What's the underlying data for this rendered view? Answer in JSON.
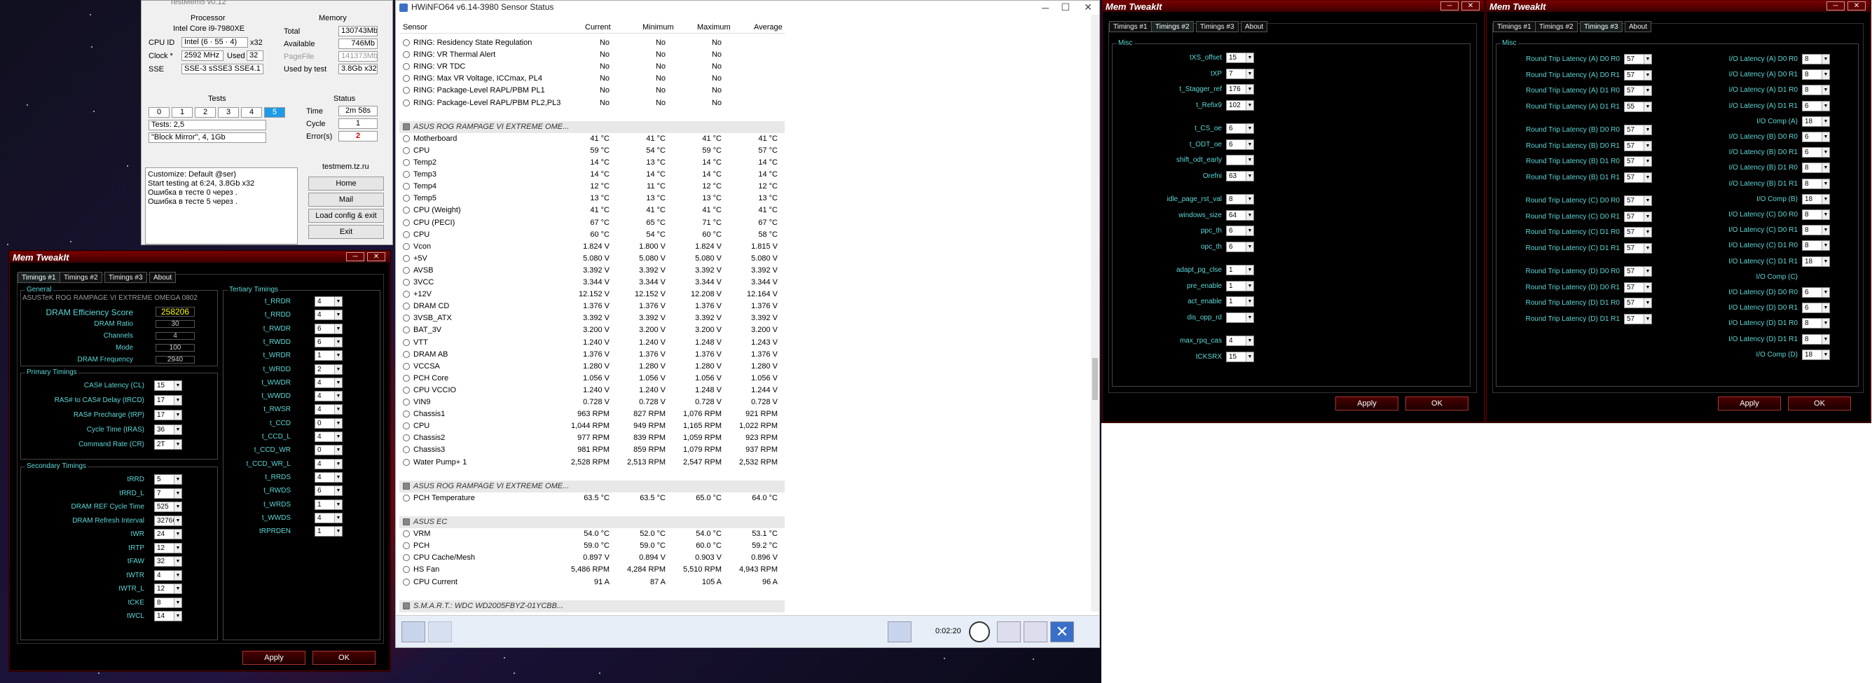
{
  "testmem": {
    "title": "TestMem5 v0.12",
    "proc_hdr": "Processor",
    "cpu": "Intel Core i9-7980XE",
    "cpuid_lbl": "CPU ID",
    "cpuid": "Intel (6 · 55 · 4)",
    "cpuid_x": "x32",
    "clock_lbl": "Clock *",
    "clock": "2592 MHz",
    "used_lbl": "Used",
    "used": "32",
    "sse_lbl": "SSE",
    "sse": "SSE-3 sSSE3 SSE4.1",
    "mem_hdr": "Memory",
    "total_lbl": "Total",
    "total": "130743Mb",
    "avail_lbl": "Available",
    "avail": "746Mb",
    "pagefile_lbl": "PageFile",
    "pagefile": "141373Mb",
    "usedby_lbl": "Used by test",
    "usedby": "3.8Gb x32",
    "tests_hdr": "Tests",
    "tests_nums": [
      "0",
      "1",
      "2",
      "3",
      "4",
      "5"
    ],
    "tests_line": "Tests: 2,5",
    "tests_mode": "\"Block Mirror\", 4, 1Gb",
    "status_hdr": "Status",
    "time_lbl": "Time",
    "time": "2m 58s",
    "cycle_lbl": "Cycle",
    "cycle": "1",
    "errors_lbl": "Error(s)",
    "errors": "2",
    "site": "testmem.tz.ru",
    "log": [
      "Customize: Default @ser)",
      "Start testing at 6:24, 3.8Gb x32",
      "Ошибка в тесте 0 через .",
      "Ошибка в тесте 5 через ."
    ],
    "btn_home": "Home",
    "btn_mail": "Mail",
    "btn_load": "Load config & exit",
    "btn_exit": "Exit"
  },
  "mt1": {
    "title": "Mem TweakIt",
    "tabs": [
      "Timings #1",
      "Timings #2",
      "Timings #3",
      "About"
    ],
    "general_lbl": "General",
    "board": "ASUSTeK ROG RAMPAGE VI EXTREME OMEGA 0802",
    "eff_lbl": "DRAM Efficiency Score",
    "eff": "258206",
    "ratio_lbl": "DRAM Ratio",
    "ratio": "30",
    "ch_lbl": "Channels",
    "ch": "4",
    "mode_lbl": "Mode",
    "mode": "100",
    "freq_lbl": "DRAM Frequency",
    "freq": "2940",
    "primary_lbl": "Primary Timings",
    "primary": [
      {
        "l": "CAS# Latency (CL)",
        "v": "15"
      },
      {
        "l": "RAS# to CAS# Delay (tRCD)",
        "v": "17"
      },
      {
        "l": "RAS# Precharge (tRP)",
        "v": "17"
      },
      {
        "l": "Cycle Time (tRAS)",
        "v": "36"
      },
      {
        "l": "Command Rate (CR)",
        "v": "2T"
      }
    ],
    "secondary_lbl": "Secondary Timings",
    "secondary": [
      {
        "l": "tRRD",
        "v": "5"
      },
      {
        "l": "tRRD_L",
        "v": "7"
      },
      {
        "l": "DRAM REF Cycle Time",
        "v": "525"
      },
      {
        "l": "DRAM Refresh Interval",
        "v": "32766"
      },
      {
        "l": "tWR",
        "v": "24"
      },
      {
        "l": "tRTP",
        "v": "12"
      },
      {
        "l": "tFAW",
        "v": "32"
      },
      {
        "l": "tWTR",
        "v": "4"
      },
      {
        "l": "tWTR_L",
        "v": "12"
      },
      {
        "l": "tCKE",
        "v": "8"
      },
      {
        "l": "tWCL",
        "v": "14"
      }
    ],
    "tertiary_lbl": "Tertiary Timings",
    "tertiary": [
      {
        "l": "t_RRDR",
        "v": "4"
      },
      {
        "l": "t_RRDD",
        "v": "4"
      },
      {
        "l": "t_RWDR",
        "v": "6"
      },
      {
        "l": "t_RWDD",
        "v": "6"
      },
      {
        "l": "t_WRDR",
        "v": "1"
      },
      {
        "l": "t_WRDD",
        "v": "2"
      },
      {
        "l": "t_WWDR",
        "v": "4"
      },
      {
        "l": "t_WWDD",
        "v": "4"
      },
      {
        "l": "t_RWSR",
        "v": "4"
      },
      {
        "l": "t_CCD",
        "v": "0"
      },
      {
        "l": "t_CCD_L",
        "v": "4"
      },
      {
        "l": "t_CCD_WR",
        "v": "0"
      },
      {
        "l": "t_CCD_WR_L",
        "v": "4"
      },
      {
        "l": "t_RRDS",
        "v": "4"
      },
      {
        "l": "t_RWDS",
        "v": "6"
      },
      {
        "l": "t_WRDS",
        "v": "1"
      },
      {
        "l": "t_WWDS",
        "v": "4"
      },
      {
        "l": "tRPRDEN",
        "v": "1"
      }
    ],
    "apply": "Apply",
    "ok": "OK"
  },
  "mt2": {
    "title": "Mem TweakIt",
    "tabs": [
      "Timings #1",
      "Timings #2",
      "Timings #3",
      "About"
    ],
    "misc_lbl": "Misc",
    "rows": [
      {
        "l": "tXS_offset",
        "v": "15"
      },
      {
        "l": "tXP",
        "v": "7"
      },
      {
        "l": "t_Stagger_ref",
        "v": "176"
      },
      {
        "l": "t_Refix9",
        "v": "102"
      },
      {
        "l": "t_CS_oe",
        "v": "6"
      },
      {
        "l": "t_ODT_oe",
        "v": "6"
      },
      {
        "l": "shift_odt_early",
        "v": ""
      },
      {
        "l": "Orefni",
        "v": "63"
      },
      {
        "l": "idle_page_rst_val",
        "v": "8"
      },
      {
        "l": "windows_size",
        "v": "64"
      },
      {
        "l": "ppc_th",
        "v": "6"
      },
      {
        "l": "opc_th",
        "v": "6"
      },
      {
        "l": "adapt_pg_clse",
        "v": "1"
      },
      {
        "l": "pre_enable",
        "v": "1"
      },
      {
        "l": "act_enable",
        "v": "1"
      },
      {
        "l": "dis_opp_rd",
        "v": ""
      },
      {
        "l": "max_rpq_cas",
        "v": "4"
      },
      {
        "l": "tCKSRX",
        "v": "15"
      }
    ],
    "apply": "Apply",
    "ok": "OK"
  },
  "mt3": {
    "title": "Mem TweakIt",
    "tabs": [
      "Timings #1",
      "Timings #2",
      "Timings #3",
      "About"
    ],
    "misc_lbl": "Misc",
    "left": [
      {
        "l": "Round Trip Latency (A) D0 R0",
        "v": "57"
      },
      {
        "l": "Round Trip Latency (A) D0 R1",
        "v": "57"
      },
      {
        "l": "Round Trip Latency (A) D1 R0",
        "v": "57"
      },
      {
        "l": "Round Trip Latency (A) D1 R1",
        "v": "55"
      },
      {
        "l": "Round Trip Latency (B) D0 R0",
        "v": "57"
      },
      {
        "l": "Round Trip Latency (B) D0 R1",
        "v": "57"
      },
      {
        "l": "Round Trip Latency (B) D1 R0",
        "v": "57"
      },
      {
        "l": "Round Trip Latency (B) D1 R1",
        "v": "57"
      },
      {
        "l": "Round Trip Latency (C) D0 R0",
        "v": "57"
      },
      {
        "l": "Round Trip Latency (C) D0 R1",
        "v": "57"
      },
      {
        "l": "Round Trip Latency (C) D1 R0",
        "v": "57"
      },
      {
        "l": "Round Trip Latency (C) D1 R1",
        "v": "57"
      },
      {
        "l": "Round Trip Latency (D) D0 R0",
        "v": "57"
      },
      {
        "l": "Round Trip Latency (D) D0 R1",
        "v": "57"
      },
      {
        "l": "Round Trip Latency (D) D1 R0",
        "v": "57"
      },
      {
        "l": "Round Trip Latency (D) D1 R1",
        "v": "57"
      }
    ],
    "right": [
      {
        "l": "I/O Latency (A) D0 R0",
        "v": "8"
      },
      {
        "l": "I/O Latency (A) D0 R1",
        "v": "8"
      },
      {
        "l": "I/O Latency (A) D1 R0",
        "v": "8"
      },
      {
        "l": "I/O Latency (A) D1 R1",
        "v": "6"
      },
      {
        "l": "I/O Comp (A)",
        "v": "18"
      },
      {
        "l": "I/O Latency (B) D0 R0",
        "v": "6"
      },
      {
        "l": "I/O Latency (B) D0 R1",
        "v": "6"
      },
      {
        "l": "I/O Latency (B) D1 R0",
        "v": "8"
      },
      {
        "l": "I/O Latency (B) D1 R1",
        "v": "8"
      },
      {
        "l": "I/O Comp (B)",
        "v": "18"
      },
      {
        "l": "I/O Latency (C) D0 R0",
        "v": "8"
      },
      {
        "l": "I/O Latency (C) D0 R1",
        "v": "8"
      },
      {
        "l": "I/O Latency (C) D1 R0",
        "v": "8"
      },
      {
        "l": "I/O Latency (C) D1 R1",
        "v": "18"
      },
      {
        "l": "I/O Comp (C)",
        "v": ""
      },
      {
        "l": "I/O Latency (D) D0 R0",
        "v": "6"
      },
      {
        "l": "I/O Latency (D) D0 R1",
        "v": "6"
      },
      {
        "l": "I/O Latency (D) D1 R0",
        "v": "8"
      },
      {
        "l": "I/O Latency (D) D1 R1",
        "v": "8"
      },
      {
        "l": "I/O Comp (D)",
        "v": "18"
      }
    ],
    "apply": "Apply",
    "ok": "OK"
  },
  "hwinfo": {
    "title": "HWiNFO64 v6.14-3980 Sensor Status",
    "cols": [
      "Sensor",
      "Current",
      "Minimum",
      "Maximum",
      "Average"
    ],
    "rows": [
      {
        "n": "RING: Residency State Regulation",
        "c": "No",
        "mi": "No",
        "ma": "No",
        "a": ""
      },
      {
        "n": "RING: VR Thermal Alert",
        "c": "No",
        "mi": "No",
        "ma": "No",
        "a": ""
      },
      {
        "n": "RING: VR TDC",
        "c": "No",
        "mi": "No",
        "ma": "No",
        "a": ""
      },
      {
        "n": "RING: Max VR Voltage, ICCmax, PL4",
        "c": "No",
        "mi": "No",
        "ma": "No",
        "a": ""
      },
      {
        "n": "RING: Package-Level RAPL/PBM PL1",
        "c": "No",
        "mi": "No",
        "ma": "No",
        "a": ""
      },
      {
        "n": "RING: Package-Level RAPL/PBM PL2,PL3",
        "c": "No",
        "mi": "No",
        "ma": "No",
        "a": ""
      },
      {
        "n": "",
        "c": "",
        "mi": "",
        "ma": "",
        "a": ""
      },
      {
        "n": "ASUS ROG RAMPAGE VI EXTREME OME...",
        "c": "",
        "mi": "",
        "ma": "",
        "a": "",
        "g": true
      },
      {
        "n": "Motherboard",
        "c": "41 °C",
        "mi": "41 °C",
        "ma": "41 °C",
        "a": "41 °C"
      },
      {
        "n": "CPU",
        "c": "59 °C",
        "mi": "54 °C",
        "ma": "59 °C",
        "a": "57 °C"
      },
      {
        "n": "Temp2",
        "c": "14 °C",
        "mi": "13 °C",
        "ma": "14 °C",
        "a": "14 °C"
      },
      {
        "n": "Temp3",
        "c": "14 °C",
        "mi": "14 °C",
        "ma": "14 °C",
        "a": "14 °C"
      },
      {
        "n": "Temp4",
        "c": "12 °C",
        "mi": "11 °C",
        "ma": "12 °C",
        "a": "12 °C"
      },
      {
        "n": "Temp5",
        "c": "13 °C",
        "mi": "13 °C",
        "ma": "13 °C",
        "a": "13 °C"
      },
      {
        "n": "CPU (Weight)",
        "c": "41 °C",
        "mi": "41 °C",
        "ma": "41 °C",
        "a": "41 °C"
      },
      {
        "n": "CPU (PECI)",
        "c": "67 °C",
        "mi": "65 °C",
        "ma": "71 °C",
        "a": "67 °C"
      },
      {
        "n": "CPU",
        "c": "60 °C",
        "mi": "54 °C",
        "ma": "60 °C",
        "a": "58 °C"
      },
      {
        "n": "Vcon",
        "c": "1.824 V",
        "mi": "1.800 V",
        "ma": "1.824 V",
        "a": "1.815 V"
      },
      {
        "n": "+5V",
        "c": "5.080 V",
        "mi": "5.080 V",
        "ma": "5.080 V",
        "a": "5.080 V"
      },
      {
        "n": "AVSB",
        "c": "3.392 V",
        "mi": "3.392 V",
        "ma": "3.392 V",
        "a": "3.392 V"
      },
      {
        "n": "3VCC",
        "c": "3.344 V",
        "mi": "3.344 V",
        "ma": "3.344 V",
        "a": "3.344 V"
      },
      {
        "n": "+12V",
        "c": "12.152 V",
        "mi": "12.152 V",
        "ma": "12.208 V",
        "a": "12.164 V"
      },
      {
        "n": "DRAM CD",
        "c": "1.376 V",
        "mi": "1.376 V",
        "ma": "1.376 V",
        "a": "1.376 V"
      },
      {
        "n": "3VSB_ATX",
        "c": "3.392 V",
        "mi": "3.392 V",
        "ma": "3.392 V",
        "a": "3.392 V"
      },
      {
        "n": "BAT_3V",
        "c": "3.200 V",
        "mi": "3.200 V",
        "ma": "3.200 V",
        "a": "3.200 V"
      },
      {
        "n": "VTT",
        "c": "1.240 V",
        "mi": "1.240 V",
        "ma": "1.248 V",
        "a": "1.243 V"
      },
      {
        "n": "DRAM AB",
        "c": "1.376 V",
        "mi": "1.376 V",
        "ma": "1.376 V",
        "a": "1.376 V"
      },
      {
        "n": "VCCSA",
        "c": "1.280 V",
        "mi": "1.280 V",
        "ma": "1.280 V",
        "a": "1.280 V"
      },
      {
        "n": "PCH Core",
        "c": "1.056 V",
        "mi": "1.056 V",
        "ma": "1.056 V",
        "a": "1.056 V"
      },
      {
        "n": "CPU VCCIO",
        "c": "1.240 V",
        "mi": "1.240 V",
        "ma": "1.248 V",
        "a": "1.244 V"
      },
      {
        "n": "VIN9",
        "c": "0.728 V",
        "mi": "0.728 V",
        "ma": "0.728 V",
        "a": "0.728 V"
      },
      {
        "n": "Chassis1",
        "c": "963 RPM",
        "mi": "827 RPM",
        "ma": "1,076 RPM",
        "a": "921 RPM"
      },
      {
        "n": "CPU",
        "c": "1,044 RPM",
        "mi": "949 RPM",
        "ma": "1,165 RPM",
        "a": "1,022 RPM"
      },
      {
        "n": "Chassis2",
        "c": "977 RPM",
        "mi": "839 RPM",
        "ma": "1,059 RPM",
        "a": "923 RPM"
      },
      {
        "n": "Chassis3",
        "c": "981 RPM",
        "mi": "859 RPM",
        "ma": "1,079 RPM",
        "a": "937 RPM"
      },
      {
        "n": "Water Pump+ 1",
        "c": "2,528 RPM",
        "mi": "2,513 RPM",
        "ma": "2,547 RPM",
        "a": "2,532 RPM"
      },
      {
        "n": "",
        "c": "",
        "mi": "",
        "ma": "",
        "a": ""
      },
      {
        "n": "ASUS ROG RAMPAGE VI EXTREME OME...",
        "c": "",
        "mi": "",
        "ma": "",
        "a": "",
        "g": true
      },
      {
        "n": "PCH Temperature",
        "c": "63.5 °C",
        "mi": "63.5 °C",
        "ma": "65.0 °C",
        "a": "64.0 °C"
      },
      {
        "n": "",
        "c": "",
        "mi": "",
        "ma": "",
        "a": ""
      },
      {
        "n": "ASUS EC",
        "c": "",
        "mi": "",
        "ma": "",
        "a": "",
        "g": true
      },
      {
        "n": "VRM",
        "c": "54.0 °C",
        "mi": "52.0 °C",
        "ma": "54.0 °C",
        "a": "53.1 °C"
      },
      {
        "n": "PCH",
        "c": "59.0 °C",
        "mi": "59.0 °C",
        "ma": "60.0 °C",
        "a": "59.2 °C"
      },
      {
        "n": "CPU Cache/Mesh",
        "c": "0.897 V",
        "mi": "0.894 V",
        "ma": "0.903 V",
        "a": "0.896 V"
      },
      {
        "n": "HS Fan",
        "c": "5,486 RPM",
        "mi": "4,284 RPM",
        "ma": "5,510 RPM",
        "a": "4,943 RPM"
      },
      {
        "n": "CPU Current",
        "c": "91 A",
        "mi": "87 A",
        "ma": "105 A",
        "a": "96 A"
      },
      {
        "n": "",
        "c": "",
        "mi": "",
        "ma": "",
        "a": ""
      },
      {
        "n": "S.M.A.R.T.: WDC WD2005FBYZ-01YCBB...",
        "c": "",
        "mi": "",
        "ma": "",
        "a": "",
        "g": true
      }
    ],
    "timer": "0:02:20"
  }
}
